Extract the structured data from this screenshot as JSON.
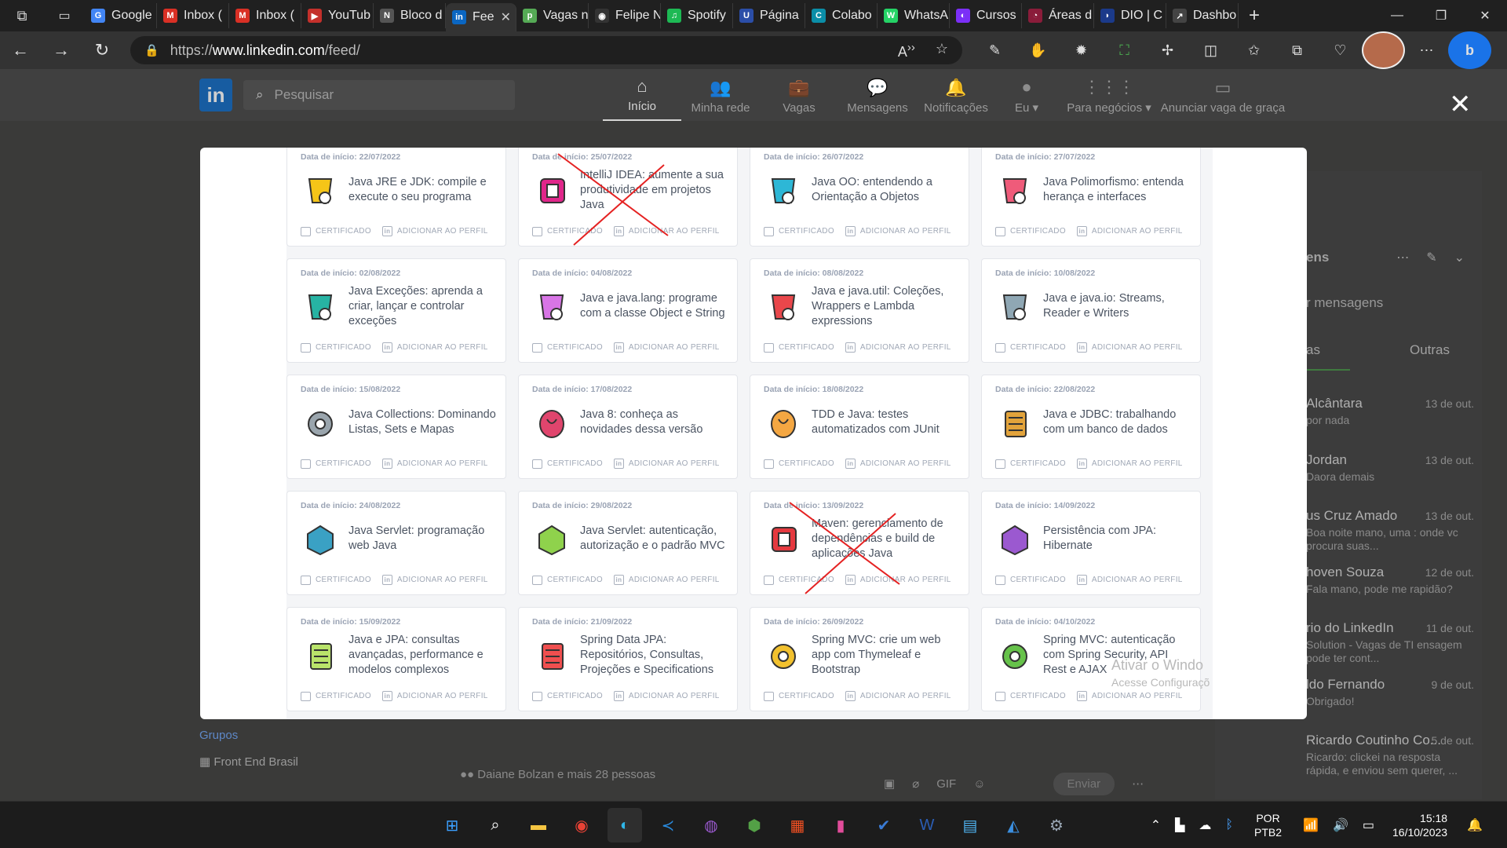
{
  "browser": {
    "tabs": [
      {
        "label": "Google",
        "color": "#4285f4",
        "glyph": "G"
      },
      {
        "label": "Inbox (",
        "color": "#d93025",
        "glyph": "M"
      },
      {
        "label": "Inbox (",
        "color": "#d93025",
        "glyph": "M"
      },
      {
        "label": "YouTub",
        "color": "#c4302b",
        "glyph": "▶"
      },
      {
        "label": "Bloco d",
        "color": "#555555",
        "glyph": "N"
      },
      {
        "label": "Fee",
        "color": "#0a66c2",
        "glyph": "in"
      },
      {
        "label": "Vagas n",
        "color": "#5a5",
        "glyph": "p"
      },
      {
        "label": "Felipe N",
        "color": "#333333",
        "glyph": "◉"
      },
      {
        "label": "Spotify",
        "color": "#1db954",
        "glyph": "♫"
      },
      {
        "label": "Página",
        "color": "#2b4ea8",
        "glyph": "U"
      },
      {
        "label": "Colabo",
        "color": "#0b8ea8",
        "glyph": "C"
      },
      {
        "label": "WhatsA",
        "color": "#25d366",
        "glyph": "W"
      },
      {
        "label": "Cursos",
        "color": "#7b2ff7",
        "glyph": "◐"
      },
      {
        "label": "Áreas d",
        "color": "#8a1c3a",
        "glyph": "◔"
      },
      {
        "label": "DIO | C",
        "color": "#1b3a8a",
        "glyph": "◗"
      },
      {
        "label": "Dashbo",
        "color": "#444444",
        "glyph": "↗"
      }
    ],
    "active_tab_index": 5,
    "url_prefix": "https://",
    "url_domain": "www.linkedin.com",
    "url_path": "/feed/"
  },
  "linkedin": {
    "search_placeholder": "Pesquisar",
    "nav": [
      {
        "label": "Início",
        "icon": "home-icon",
        "glyph": "⌂"
      },
      {
        "label": "Minha rede",
        "icon": "network-icon",
        "glyph": "👥"
      },
      {
        "label": "Vagas",
        "icon": "jobs-icon",
        "glyph": "💼"
      },
      {
        "label": "Mensagens",
        "icon": "messaging-icon",
        "glyph": "💬"
      },
      {
        "label": "Notificações",
        "icon": "bell-icon",
        "glyph": "🔔"
      },
      {
        "label": "Eu ▾",
        "icon": "me-icon",
        "glyph": "●"
      },
      {
        "label": "Para negócios ▾",
        "icon": "grid-icon",
        "glyph": "⋮⋮⋮"
      },
      {
        "label": "Anunciar vaga de graça",
        "icon": "post-job-icon",
        "glyph": "▭"
      }
    ],
    "groups_heading": "Grupos",
    "group_item": "Front End Brasil",
    "feed_reactions": "Daiane Bolzan e mais 28 pessoas",
    "send_label": "Enviar",
    "messaging": {
      "title": "ens",
      "search": "r mensagens",
      "tab_focused": "as",
      "tab_other": "Outras",
      "conversations": [
        {
          "name": "Alcântara",
          "date": "13 de out.",
          "preview": "por nada"
        },
        {
          "name": "Jordan",
          "date": "13 de out.",
          "preview": "Daora demais"
        },
        {
          "name": "us Cruz Amado",
          "date": "13 de out.",
          "preview": "Boa noite mano, uma : onde vc procura suas..."
        },
        {
          "name": "hoven Souza",
          "date": "12 de out.",
          "preview": "Fala mano, pode me rapidão?"
        },
        {
          "name": "rio do LinkedIn",
          "date": "11 de out.",
          "preview": "Solution - Vagas de TI ensagem pode ter cont..."
        },
        {
          "name": "ldo Fernando",
          "date": "9 de out.",
          "preview": "Obrigado!"
        },
        {
          "name": "Ricardo Coutinho Co...",
          "date": "5 de out.",
          "preview": "Ricardo: clickei na resposta rápida, e enviou sem querer, ..."
        }
      ]
    }
  },
  "modal": {
    "certificate_label": "CERTIFICADO",
    "profile_label": "ADICIONAR AO PERFIL",
    "courses": [
      {
        "date": "Data de início: 22/07/2022",
        "title": "Java JRE e JDK: compile e execute o seu programa",
        "color": "#f5c518",
        "crossed": false
      },
      {
        "date": "Data de início: 25/07/2022",
        "title": "IntelliJ IDEA: aumente a sua produtividade em projetos Java",
        "color": "#e0268a",
        "crossed": true
      },
      {
        "date": "Data de início: 26/07/2022",
        "title": "Java OO: entendendo a Orientação a Objetos",
        "color": "#2db7d6",
        "crossed": false
      },
      {
        "date": "Data de início: 27/07/2022",
        "title": "Java Polimorfismo: entenda herança e interfaces",
        "color": "#ef5b7a",
        "crossed": false
      },
      {
        "date": "Data de início: 02/08/2022",
        "title": "Java Exceções: aprenda a criar, lançar e controlar exceções",
        "color": "#27b3a3",
        "crossed": false
      },
      {
        "date": "Data de início: 04/08/2022",
        "title": "Java e java.lang: programe com a classe Object e String",
        "color": "#d875e6",
        "crossed": false
      },
      {
        "date": "Data de início: 08/08/2022",
        "title": "Java e java.util: Coleções, Wrappers e Lambda expressions",
        "color": "#e9474b",
        "crossed": false
      },
      {
        "date": "Data de início: 10/08/2022",
        "title": "Java e java.io: Streams, Reader e Writers",
        "color": "#8fa7b4",
        "crossed": false
      },
      {
        "date": "Data de início: 15/08/2022",
        "title": "Java Collections: Dominando Listas, Sets e Mapas",
        "color": "#9aa5ad",
        "crossed": false
      },
      {
        "date": "Data de início: 17/08/2022",
        "title": "Java 8: conheça as novidades dessa versão",
        "color": "#e0456d",
        "crossed": false
      },
      {
        "date": "Data de início: 18/08/2022",
        "title": "TDD e Java: testes automatizados com JUnit",
        "color": "#f4a742",
        "crossed": false
      },
      {
        "date": "Data de início: 22/08/2022",
        "title": "Java e JDBC: trabalhando com um banco de dados",
        "color": "#e2a33b",
        "crossed": false
      },
      {
        "date": "Data de início: 24/08/2022",
        "title": "Java Servlet: programação web Java",
        "color": "#3aa1c4",
        "crossed": false
      },
      {
        "date": "Data de início: 29/08/2022",
        "title": "Java Servlet: autenticação, autorização e o padrão MVC",
        "color": "#8fd24c",
        "crossed": false
      },
      {
        "date": "Data de início: 13/09/2022",
        "title": "Maven: gerenciamento de dependências e build de aplicações Java",
        "color": "#e5393f",
        "crossed": true
      },
      {
        "date": "Data de início: 14/09/2022",
        "title": "Persistência com JPA: Hibernate",
        "color": "#9b59d0",
        "crossed": false
      },
      {
        "date": "Data de início: 15/09/2022",
        "title": "Java e JPA: consultas avançadas, performance e modelos complexos",
        "color": "#b9e36a",
        "crossed": false
      },
      {
        "date": "Data de início: 21/09/2022",
        "title": "Spring Data JPA: Repositórios, Consultas, Projeções e Specifications",
        "color": "#ef4f4f",
        "crossed": false
      },
      {
        "date": "Data de início: 26/09/2022",
        "title": "Spring MVC: crie um web app com Thymeleaf e Bootstrap",
        "color": "#f2c12e",
        "crossed": false
      },
      {
        "date": "Data de início: 04/10/2022",
        "title": "Spring MVC: autenticação com Spring Security, API Rest e AJAX",
        "color": "#66c24a",
        "crossed": false
      }
    ]
  },
  "watermark": {
    "line1": "Ativar o Windo",
    "line2": "Acesse Configuraçõ"
  },
  "taskbar": {
    "apps": [
      {
        "name": "start-icon",
        "glyph": "⊞",
        "color": "#3ba0ff"
      },
      {
        "name": "search-icon",
        "glyph": "⌕",
        "color": "#ffffff"
      },
      {
        "name": "file-explorer-icon",
        "glyph": "▬",
        "color": "#f5c542"
      },
      {
        "name": "chrome-icon",
        "glyph": "◉",
        "color": "#e94235"
      },
      {
        "name": "edge-icon",
        "glyph": "◐",
        "color": "#2fb6e8"
      },
      {
        "name": "vscode-icon",
        "glyph": "≺",
        "color": "#2a8ce0"
      },
      {
        "name": "github-desktop-icon",
        "glyph": "◍",
        "color": "#9b59d0"
      },
      {
        "name": "nodejs-icon",
        "glyph": "⬢",
        "color": "#53a046"
      },
      {
        "name": "ms-store-icon",
        "glyph": "▦",
        "color": "#f25022"
      },
      {
        "name": "chart-app-icon",
        "glyph": "▮",
        "color": "#e14c9a"
      },
      {
        "name": "todo-icon",
        "glyph": "✔",
        "color": "#3a7bd5"
      },
      {
        "name": "word-icon",
        "glyph": "W",
        "color": "#2b5db4"
      },
      {
        "name": "notepad-icon",
        "glyph": "▤",
        "color": "#4fb3f0"
      },
      {
        "name": "photos-icon",
        "glyph": "◭",
        "color": "#3b8fe0"
      },
      {
        "name": "settings-icon",
        "glyph": "⚙",
        "color": "#9aa7b5"
      }
    ],
    "lang1": "POR",
    "lang2": "PTB2",
    "time": "15:18",
    "date": "16/10/2023"
  }
}
